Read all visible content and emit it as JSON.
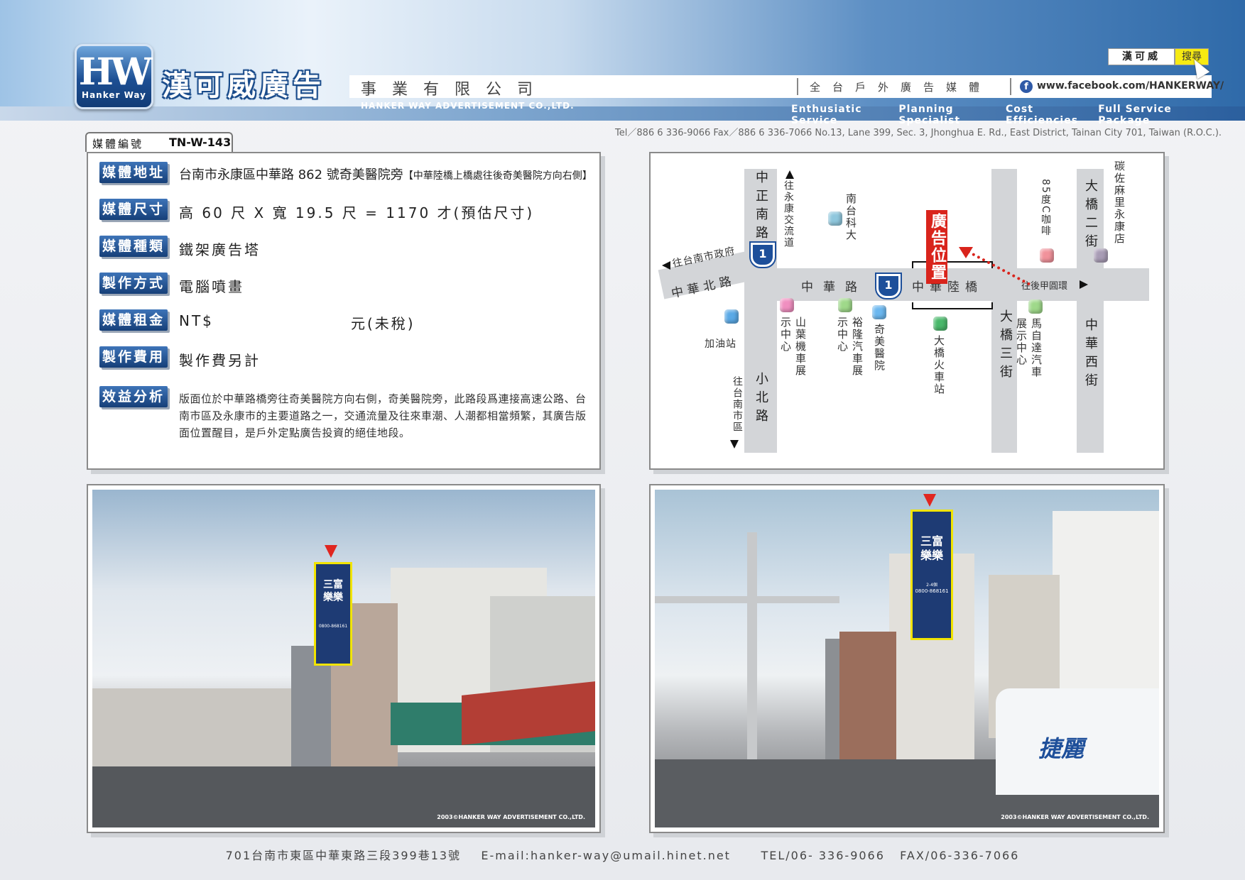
{
  "header": {
    "logo_letters": "HW",
    "logo_sub": "Hanker Way",
    "company_cn": "漢可威廣告",
    "company_suffix": "事業有限公司",
    "company_en": "HANKER WAY ADVERTISEMENT CO.,LTD.",
    "tagline": "全台戶外廣告媒體",
    "facebook_url": "www.facebook.com/HANKERWAY/",
    "search_value": "漢可威",
    "search_button": "搜尋",
    "services": [
      "Enthusiatic Service",
      "Planning Specialist",
      "Cost Efficiencies",
      "Full Service Package"
    ],
    "contact_line": "Tel／886 6 336-9066   Fax／886 6 336-7066   No.13, Lane 399, Sec. 3, Jhonghua E. Rd., East District, Tainan City 701, Taiwan (R.O.C.)."
  },
  "media": {
    "id_label": "媒體編號",
    "id_value": "TN-W-143",
    "rows": [
      {
        "label": "媒體地址",
        "value": "台南市永康區中華路 862 號奇美醫院旁",
        "note": "【中華陸橋上橋處往後奇美醫院方向右側】"
      },
      {
        "label": "媒體尺寸",
        "value": "高 60 尺 X 寬 19.5 尺 = 1170 才(預估尺寸)"
      },
      {
        "label": "媒體種類",
        "value": "鐵架廣告塔"
      },
      {
        "label": "製作方式",
        "value": "電腦噴畫"
      },
      {
        "label": "媒體租金",
        "value": "NT$",
        "value2": "元(未稅)"
      },
      {
        "label": "製作費用",
        "value": "製作費另計"
      },
      {
        "label": "效益分析",
        "value": "版面位於中華路橋旁往奇美醫院方向右側，奇美醫院旁，此路段爲連接高速公路、台南市區及永康市的主要道路之一，交通流量及往來車潮、人潮都相當頻繁，其廣告版面位置醒目，是戶外定點廣告投資的絕佳地段。"
      }
    ]
  },
  "map": {
    "roads": {
      "zhongzheng_s": "中正南路",
      "xiaobei": "小北路",
      "zhonghua": "中華路",
      "zhonghua_bridge": "中華陸橋",
      "zhonghua_n": "中華北路",
      "daqiao3": "大橋三街",
      "daqiao2": "大橋二街",
      "zhonghua_w": "中華西街"
    },
    "directions": {
      "to_yongkang": "往永康交流道",
      "to_city_gov": "往台南市政府",
      "to_city": "往台南市區",
      "to_jiayuan": "往後甲圓環"
    },
    "highway_number": "1",
    "ad_tag": "廣告位置",
    "landmarks": {
      "nantai": "南台科大",
      "gas": "加油站",
      "yamaha": "山葉機車展示中心",
      "yulon": "裕隆汽車展示中心",
      "chimei": "奇美醫院",
      "daqiao_station": "大橋火車站",
      "mazda": "馬自達汽車展示中心",
      "cafe85": "85度C咖啡",
      "carrefour": "碳佐麻里永康店"
    },
    "pin_colors": {
      "nantai": "#8fc7dd",
      "gas": "#5aa9e6",
      "yamaha": "#f08fc0",
      "yulon": "#9fd98a",
      "chimei": "#6bb7ef",
      "daqiao_station": "#49b86a",
      "mazda": "#9fd98a",
      "cafe85": "#f1929b",
      "carrefour": "#a89cb5"
    }
  },
  "photos": {
    "billboard_line1": "三富",
    "billboard_line2": "樂樂",
    "billboard_phone": "0800-868161",
    "billboard_date": "2-4個",
    "bus_text": "捷麗",
    "credit": "2003©HANKER WAY ADVERTISEMENT CO.,LTD."
  },
  "footer": "701台南市東區中華東路三段399巷13號    E-mail:hanker-way@umail.hinet.net      TEL/06- 336-9066   FAX/06-336-7066"
}
